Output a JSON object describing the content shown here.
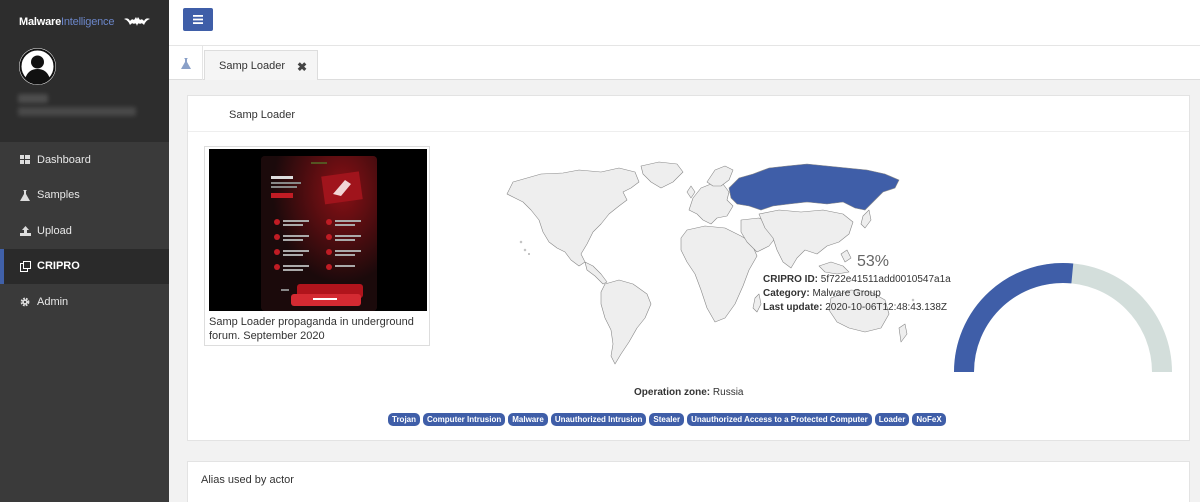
{
  "brand": {
    "name_part1": "Malware",
    "name_part2": "Intelligence"
  },
  "sidebar": {
    "items": [
      {
        "label": "Dashboard",
        "icon": "grid-icon"
      },
      {
        "label": "Samples",
        "icon": "flask-icon"
      },
      {
        "label": "Upload",
        "icon": "upload-icon"
      },
      {
        "label": "CRIPRO",
        "icon": "copy-icon",
        "active": true
      },
      {
        "label": "Admin",
        "icon": "gear-icon"
      }
    ]
  },
  "tabs": [
    {
      "label": "Samp Loader"
    }
  ],
  "card": {
    "title": "Samp Loader",
    "caption": "Samp Loader propaganda in underground forum. September 2020",
    "operation_zone_label": "Operation zone:",
    "operation_zone_value": "Russia",
    "tags": [
      "Trojan",
      "Computer Intrusion",
      "Malware",
      "Unauthorized Intrusion",
      "Stealer",
      "Unauthorized Access to a Protected Computer",
      "Loader",
      "NoFeX"
    ],
    "gauge_percent_text": "53%",
    "gauge_value": 0.53,
    "cripro_id_label": "CRIPRO ID:",
    "cripro_id": "5f722e41511add0010547a1a",
    "category_label": "Category:",
    "category": "Malware Group",
    "last_update_label": "Last update:",
    "last_update": "2020-10-06T12:48:43.138Z"
  },
  "card2": {
    "title": "Alias used by actor"
  },
  "colors": {
    "accent": "#3f5ea8",
    "gauge_rest": "#d3dedb",
    "sidebar": "#3a3a3a"
  }
}
